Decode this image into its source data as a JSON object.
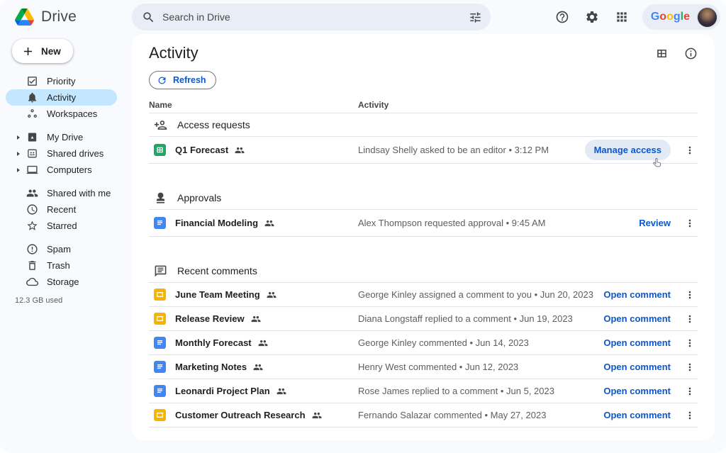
{
  "colors": {
    "background": "#F8FAFD",
    "surface": "#FFFFFF",
    "search-bg": "#E9EEF6",
    "active-pill": "#C2E7FF",
    "link-blue": "#0B57D0",
    "hover-pill": "#E2EAF6",
    "text-primary": "#1F1F1F",
    "text-secondary": "#5E5E5E",
    "divider": "#E2E3E6",
    "sheets-green": "#23A566",
    "docs-blue": "#4285F4",
    "slides-yellow": "#F4B400"
  },
  "topbar": {
    "app_name": "Drive",
    "search": {
      "placeholder": "Search in Drive"
    },
    "google_logo": "Google",
    "google_letter_colors": [
      "#4285F4",
      "#EA4335",
      "#FBBC05",
      "#4285F4",
      "#34A853",
      "#EA4335"
    ]
  },
  "sidebar": {
    "new_button": "New",
    "groups": [
      {
        "items": [
          {
            "label": "Priority",
            "icon": "priority"
          },
          {
            "label": "Activity",
            "icon": "bell",
            "active": true
          },
          {
            "label": "Workspaces",
            "icon": "workspaces"
          }
        ]
      },
      {
        "items": [
          {
            "label": "My Drive",
            "icon": "my-drive",
            "caret": true
          },
          {
            "label": "Shared drives",
            "icon": "shared-drives",
            "caret": true
          },
          {
            "label": "Computers",
            "icon": "computers",
            "caret": true
          }
        ]
      },
      {
        "items": [
          {
            "label": "Shared with me",
            "icon": "people"
          },
          {
            "label": "Recent",
            "icon": "clock"
          },
          {
            "label": "Starred",
            "icon": "star"
          }
        ]
      },
      {
        "items": [
          {
            "label": "Spam",
            "icon": "spam"
          },
          {
            "label": "Trash",
            "icon": "trash"
          },
          {
            "label": "Storage",
            "icon": "cloud"
          }
        ]
      }
    ],
    "storage_used": "12.3 GB used"
  },
  "main": {
    "title": "Activity",
    "refresh_label": "Refresh",
    "columns": {
      "name": "Name",
      "activity": "Activity"
    },
    "sections": [
      {
        "icon": "person-add",
        "title": "Access requests",
        "rows": [
          {
            "file_icon": "sheets",
            "name": "Q1 Forecast",
            "shared": true,
            "activity": "Lindsay Shelly asked to be an editor • 3:12 PM",
            "action": "Manage access",
            "hovered": true
          }
        ]
      },
      {
        "icon": "approval",
        "title": "Approvals",
        "rows": [
          {
            "file_icon": "docs",
            "name": "Financial Modeling",
            "shared": true,
            "activity": "Alex Thompson requested approval • 9:45 AM",
            "action": "Review"
          }
        ]
      },
      {
        "icon": "comment",
        "title": "Recent comments",
        "rows": [
          {
            "file_icon": "slides",
            "name": "June Team Meeting",
            "shared": true,
            "activity": "George Kinley assigned a comment to you • Jun 20, 2023",
            "action": "Open comment"
          },
          {
            "file_icon": "slides",
            "name": "Release Review",
            "shared": true,
            "activity": "Diana Longstaff replied to a comment • Jun 19, 2023",
            "action": "Open comment"
          },
          {
            "file_icon": "docs",
            "name": "Monthly Forecast",
            "shared": true,
            "activity": "George Kinley commented • Jun 14, 2023",
            "action": "Open comment"
          },
          {
            "file_icon": "docs",
            "name": "Marketing Notes",
            "shared": true,
            "activity": "Henry West commented • Jun 12, 2023",
            "action": "Open comment"
          },
          {
            "file_icon": "docs",
            "name": "Leonardi Project Plan",
            "shared": true,
            "activity": "Rose James replied to a comment • Jun 5, 2023",
            "action": "Open comment"
          },
          {
            "file_icon": "slides",
            "name": "Customer Outreach Research",
            "shared": true,
            "activity": "Fernando Salazar commented • May 27, 2023",
            "action": "Open comment"
          }
        ]
      }
    ]
  }
}
